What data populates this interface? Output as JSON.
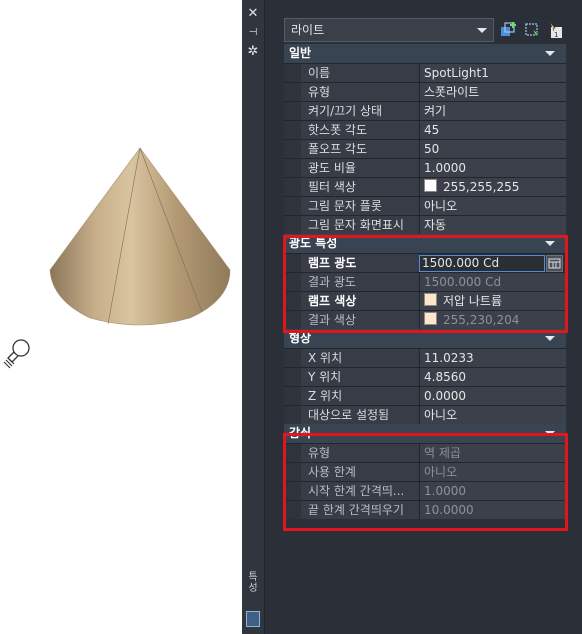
{
  "toolbar": {
    "light_type": "라이트",
    "icons": [
      "add-light-icon",
      "quick-select-icon",
      "toggle-pickadd-icon"
    ]
  },
  "palette_title": "특성",
  "sections": [
    {
      "id": "general",
      "title": "일반",
      "rows": [
        {
          "name": "이름",
          "value": "SpotLight1"
        },
        {
          "name": "유형",
          "value": "스폿라이트"
        },
        {
          "name": "켜기/끄기 상태",
          "value": "켜기"
        },
        {
          "name": "핫스폿 각도",
          "value": "45"
        },
        {
          "name": "폴오프 각도",
          "value": "50"
        },
        {
          "name": "광도 비율",
          "value": "1.0000"
        },
        {
          "name": "필터 색상",
          "value": "255,255,255",
          "swatch": "#ffffff"
        },
        {
          "name": "그림 문자 플롯",
          "value": "아니오"
        },
        {
          "name": "그림 문자 화면표시",
          "value": "자동"
        }
      ]
    },
    {
      "id": "photometric",
      "title": "광도 특성",
      "rows": [
        {
          "name": "램프 광도",
          "value": "1500.000 Cd"
        },
        {
          "name": "결과 광도",
          "value": "1500.000 Cd"
        },
        {
          "name": "램프 색상",
          "value": "저압 나트륨",
          "swatch": "#fde5c8"
        },
        {
          "name": "결과 색상",
          "value": "255,230,204",
          "swatch": "#ffe6cc"
        }
      ]
    },
    {
      "id": "geometry",
      "title": "형상",
      "rows": [
        {
          "name": "X 위치",
          "value": "11.0233"
        },
        {
          "name": "Y 위치",
          "value": "4.8560"
        },
        {
          "name": "Z 위치",
          "value": "0.0000"
        },
        {
          "name": "대상으로 설정됨",
          "value": "아니오"
        }
      ]
    },
    {
      "id": "attenuation",
      "title": "감쇠",
      "rows": [
        {
          "name": "유형",
          "value": "역 제곱"
        },
        {
          "name": "사용 한계",
          "value": "아니오"
        },
        {
          "name": "시작 한계 간격띄...",
          "value": "1.0000"
        },
        {
          "name": "끝 한계 간격띄우기",
          "value": "10.0000"
        }
      ]
    }
  ],
  "colors": {
    "highlight": "#e0161e",
    "palette_bg": "#2b2f38",
    "cone_face": "#bfa37c"
  }
}
